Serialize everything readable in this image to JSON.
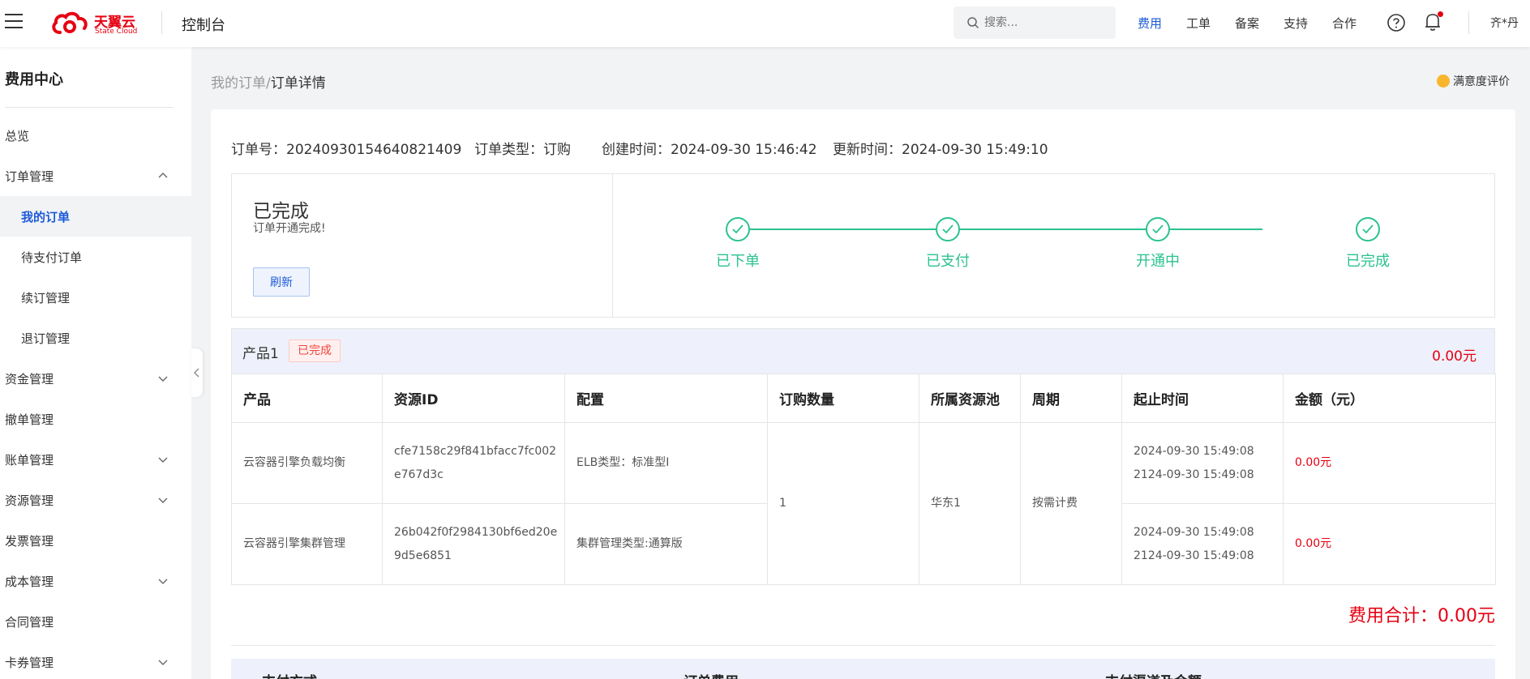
{
  "header": {
    "logo_cn": "天翼云",
    "logo_en": "State Cloud",
    "console": "控制台",
    "search_placeholder": "搜索...",
    "nav": [
      {
        "label": "费用",
        "active": true
      },
      {
        "label": "工单",
        "active": false
      },
      {
        "label": "备案",
        "active": false
      },
      {
        "label": "支持",
        "active": false
      },
      {
        "label": "合作",
        "active": false
      }
    ],
    "user": "齐*丹",
    "icons": [
      "menu-icon",
      "search-icon",
      "help-icon",
      "bell-icon"
    ]
  },
  "sidebar": {
    "title": "费用中心",
    "items": [
      {
        "label": "总览",
        "level": "top"
      },
      {
        "label": "订单管理",
        "level": "top",
        "chevron": "up"
      },
      {
        "label": "我的订单",
        "level": "sub",
        "active": true
      },
      {
        "label": "待支付订单",
        "level": "sub"
      },
      {
        "label": "续订管理",
        "level": "sub"
      },
      {
        "label": "退订管理",
        "level": "sub"
      },
      {
        "label": "资金管理",
        "level": "top",
        "chevron": "down"
      },
      {
        "label": "撤单管理",
        "level": "top"
      },
      {
        "label": "账单管理",
        "level": "top",
        "chevron": "down"
      },
      {
        "label": "资源管理",
        "level": "top",
        "chevron": "down"
      },
      {
        "label": "发票管理",
        "level": "top"
      },
      {
        "label": "成本管理",
        "level": "top",
        "chevron": "down"
      },
      {
        "label": "合同管理",
        "level": "top"
      },
      {
        "label": "卡券管理",
        "level": "top",
        "chevron": "down"
      }
    ]
  },
  "breadcrumb": {
    "parent": "我的订单",
    "sep": "/",
    "current": "订单详情"
  },
  "rating": "满意度评价",
  "order": {
    "no": "订单号：20240930154640821409",
    "type": "订单类型：订购",
    "created": "创建时间：2024-09-30 15:46:42",
    "updated": "更新时间：2024-09-30 15:49:10"
  },
  "status": {
    "title": "已完成",
    "subtitle": "订单开通完成!",
    "refresh": "刷新",
    "steps": [
      "已下单",
      "已支付",
      "开通中",
      "已完成"
    ],
    "accent": "#2bc28e"
  },
  "product": {
    "name": "产品1",
    "badge": "已完成",
    "amount": "0.00元"
  },
  "table": {
    "headers": [
      "产品",
      "资源ID",
      "配置",
      "订购数量",
      "所属资源池",
      "周期",
      "起止时间",
      "金额（元）"
    ],
    "rows": [
      {
        "product": "云容器引擎负载均衡",
        "resource_id": "cfe7158c29f841bfacc7fc002e767d3c",
        "config": "ELB类型：标准型I",
        "start": "2024-09-30 15:49:08",
        "end": "2124-09-30 15:49:08",
        "amount": "0.00元"
      },
      {
        "product": "云容器引擎集群管理",
        "resource_id": "26b042f0f2984130bf6ed20e9d5e6851",
        "config": "集群管理类型:通算版",
        "start": "2024-09-30 15:49:08",
        "end": "2124-09-30 15:49:08",
        "amount": "0.00元"
      }
    ],
    "shared": {
      "quantity": "1",
      "pool": "华东1",
      "period": "按需计费"
    }
  },
  "total": "费用合计：0.00元",
  "payment_headers": [
    "支付方式",
    "订单费用",
    "支付渠道及金额"
  ]
}
